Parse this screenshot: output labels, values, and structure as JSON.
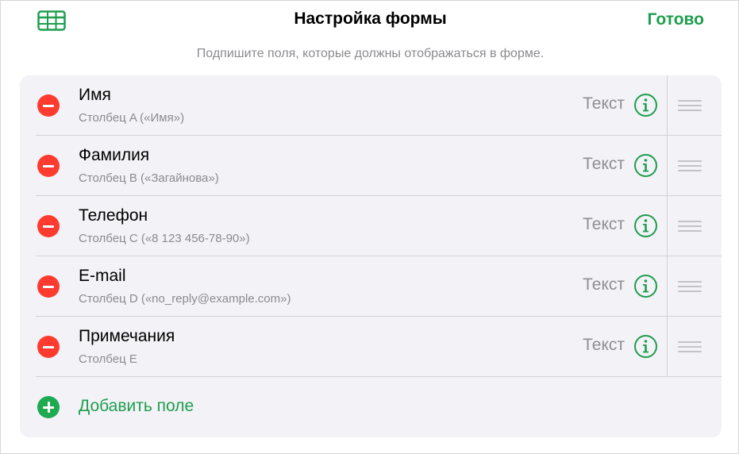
{
  "header": {
    "title": "Настройка формы",
    "done_label": "Готово",
    "subtitle": "Подпишите поля, которые должны отображаться в форме."
  },
  "fields": [
    {
      "name": "Имя",
      "column": "Столбец A («Имя»)",
      "type": "Текст"
    },
    {
      "name": "Фамилия",
      "column": "Столбец B («Загайнова»)",
      "type": "Текст"
    },
    {
      "name": "Телефон",
      "column": "Столбец C («8 123 456-78-90»)",
      "type": "Текст"
    },
    {
      "name": "E-mail",
      "column": "Столбец D («no_reply@example.com»)",
      "type": "Текст"
    },
    {
      "name": "Примечания",
      "column": "Столбец E",
      "type": "Текст"
    }
  ],
  "add_field_label": "Добавить поле",
  "colors": {
    "accent_green": "#1e9e4e",
    "remove_red": "#ff3b30",
    "secondary_text": "#8b8b8f",
    "card_background": "#f2f2f7"
  },
  "icons": {
    "table": "table-icon",
    "remove": "minus-circle-icon",
    "info": "info-circle-icon",
    "reorder": "reorder-grip-icon",
    "add": "plus-circle-icon"
  }
}
